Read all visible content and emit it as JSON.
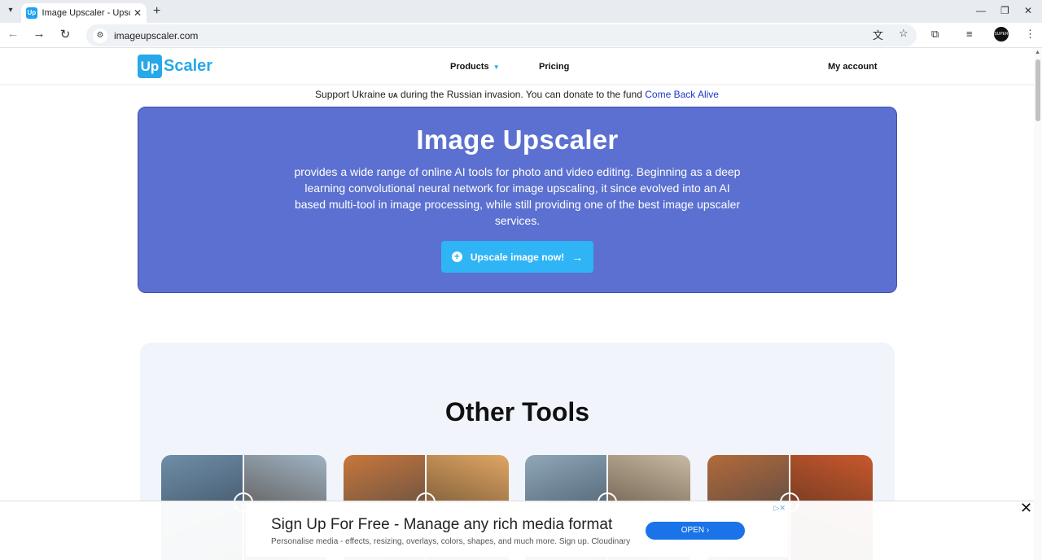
{
  "browser": {
    "tab_title": "Image Upscaler - Upscale Y",
    "favicon_text": "Up",
    "url": "imageupscaler.com",
    "profile_text": "SUPER"
  },
  "site": {
    "logo_mark": "Up",
    "logo_text": "Scaler",
    "nav": {
      "products": "Products",
      "pricing": "Pricing",
      "account": "My account"
    }
  },
  "donate": {
    "text": "Support Ukraine",
    "flag": "UA",
    "text2": "during the Russian invasion. You can donate to the fund",
    "link": "Come Back Alive"
  },
  "hero": {
    "title": "Image Upscaler",
    "description": "provides a wide range of online AI tools for photo and video editing. Beginning as a deep learning convolutional neural network for image upscaling, it since evolved into an AI based multi-tool in image processing, while still providing one of the best image upscaler services.",
    "button_label": "Upscale image now!"
  },
  "tools": {
    "title": "Other Tools",
    "cards": [
      {
        "name": "frosted-leaf",
        "color_left": "#6f8ea8",
        "color_right": "#9fb3c4"
      },
      {
        "name": "cat-autumn",
        "color_left": "#c8773a",
        "color_right": "#e0a664"
      },
      {
        "name": "woman-portrait",
        "color_left": "#8fa8b8",
        "color_right": "#c7b9a3"
      },
      {
        "name": "autumn-leaf",
        "color_left": "#b36a3a",
        "color_right": "#c9572d"
      }
    ]
  },
  "ad": {
    "title": "Sign Up For Free - Manage any rich media format",
    "subtitle": "Personalise media - effects, resizing, overlays, colors, shapes, and much more. Sign up. Cloudinary",
    "button": "OPEN"
  },
  "colors": {
    "accent": "#27a8e8",
    "hero_bg": "#5b70d0",
    "button_bg": "#2fb4f5"
  }
}
